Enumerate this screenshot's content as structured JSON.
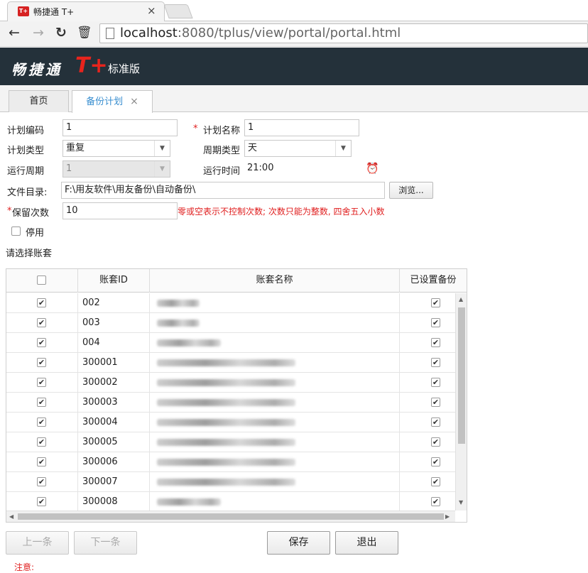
{
  "browser": {
    "tab_title": "畅捷通 T+",
    "tab_close": "×",
    "url_host": "localhost",
    "url_rest": ":8080/tplus/view/portal/portal.html"
  },
  "app": {
    "brand": "畅捷通",
    "brand_t": "T+",
    "edition": "标准版"
  },
  "tabs": [
    {
      "label": "首页"
    },
    {
      "label": "备份计划",
      "close": "×"
    }
  ],
  "form": {
    "plan_code_label": "计划编码",
    "plan_code_value": "1",
    "plan_name_label": "计划名称",
    "plan_name_value": "1",
    "plan_type_label": "计划类型",
    "plan_type_value": "重复",
    "cycle_type_label": "周期类型",
    "cycle_type_value": "天",
    "run_cycle_label": "运行周期",
    "run_cycle_value": "1",
    "run_time_label": "运行时间",
    "run_time_value": "21:00",
    "dir_label": "文件目录:",
    "dir_value": "F:\\用友软件\\用友备份\\自动备份\\",
    "browse_label": "浏览...",
    "keep_label": "保留次数",
    "keep_value": "10",
    "keep_hint": "零或空表示不控制次数; 次数只能为整数, 四舍五入小数",
    "disable_label": "停用",
    "select_label": "请选择账套"
  },
  "grid": {
    "headers": {
      "id": "账套ID",
      "name": "账套名称",
      "backup": "已设置备份"
    },
    "rows": [
      {
        "id": "002",
        "checked": true,
        "backup": true
      },
      {
        "id": "003",
        "checked": true,
        "backup": true
      },
      {
        "id": "004",
        "checked": true,
        "backup": true
      },
      {
        "id": "300001",
        "checked": true,
        "backup": true
      },
      {
        "id": "300002",
        "checked": true,
        "backup": true
      },
      {
        "id": "300003",
        "checked": true,
        "backup": true
      },
      {
        "id": "300004",
        "checked": true,
        "backup": true
      },
      {
        "id": "300005",
        "checked": true,
        "backup": true
      },
      {
        "id": "300006",
        "checked": true,
        "backup": true
      },
      {
        "id": "300007",
        "checked": true,
        "backup": true
      },
      {
        "id": "300008",
        "checked": true,
        "backup": true
      }
    ]
  },
  "buttons": {
    "prev": "上一条",
    "next": "下一条",
    "save": "保存",
    "exit": "退出"
  },
  "note": "注意:"
}
